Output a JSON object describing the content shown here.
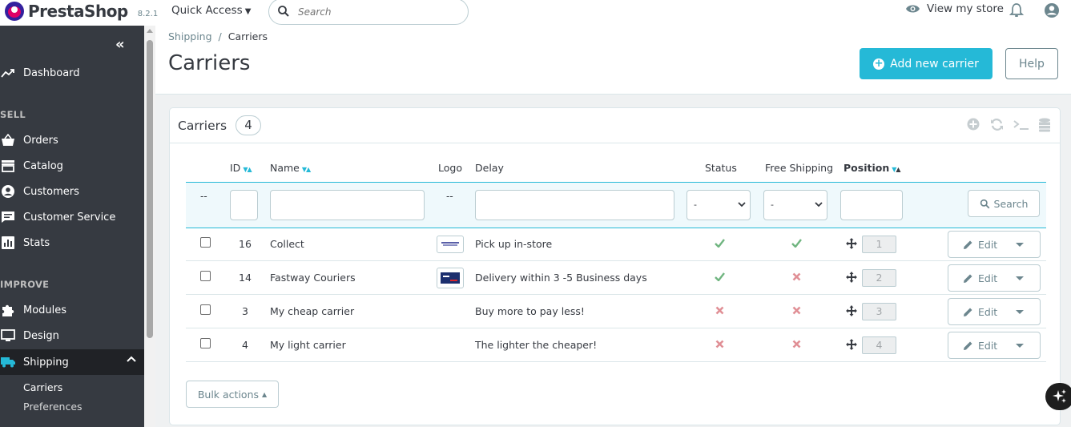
{
  "header": {
    "brand": "PrestaShop",
    "version": "8.2.1",
    "quick_access": "Quick Access",
    "search_placeholder": "Search",
    "view_store": "View my store"
  },
  "sidebar": {
    "items": [
      {
        "label": "Dashboard",
        "icon": "trending-up-icon"
      },
      {
        "label": "Orders",
        "icon": "basket-icon"
      },
      {
        "label": "Catalog",
        "icon": "store-icon"
      },
      {
        "label": "Customers",
        "icon": "account-circle-icon"
      },
      {
        "label": "Customer Service",
        "icon": "chat-icon"
      },
      {
        "label": "Stats",
        "icon": "bar-chart-icon"
      },
      {
        "label": "Modules",
        "icon": "puzzle-icon"
      },
      {
        "label": "Design",
        "icon": "desktop-icon"
      },
      {
        "label": "Shipping",
        "icon": "truck-icon"
      }
    ],
    "sections": {
      "sell": "SELL",
      "improve": "IMPROVE"
    },
    "submenu": [
      "Carriers",
      "Preferences"
    ]
  },
  "breadcrumb": {
    "parent": "Shipping",
    "separator": "/",
    "current": "Carriers"
  },
  "page": {
    "title": "Carriers",
    "add_button": "Add new carrier",
    "help_button": "Help"
  },
  "panel": {
    "title": "Carriers",
    "count": "4",
    "columns": {
      "id": "ID",
      "name": "Name",
      "logo": "Logo",
      "delay": "Delay",
      "status": "Status",
      "free_shipping": "Free Shipping",
      "position": "Position"
    },
    "filter": {
      "dash": "--",
      "select_placeholder": "-",
      "search_button": "Search"
    },
    "rows": [
      {
        "id": "16",
        "name": "Collect",
        "delay": "Pick up in-store",
        "status": true,
        "free": true,
        "position": "1",
        "has_logo": true
      },
      {
        "id": "14",
        "name": "Fastway Couriers",
        "delay": "Delivery within 3 -5 Business days",
        "status": true,
        "free": false,
        "position": "2",
        "has_logo": true
      },
      {
        "id": "3",
        "name": "My cheap carrier",
        "delay": "Buy more to pay less!",
        "status": false,
        "free": false,
        "position": "3",
        "has_logo": false
      },
      {
        "id": "4",
        "name": "My light carrier",
        "delay": "The lighter the cheaper!",
        "status": false,
        "free": false,
        "position": "4",
        "has_logo": false
      }
    ],
    "edit_label": "Edit",
    "bulk_actions": "Bulk actions"
  },
  "colors": {
    "accent": "#25b9d7",
    "sidebar_bg": "#363a41",
    "success": "#70b580",
    "danger": "#e08f95"
  }
}
